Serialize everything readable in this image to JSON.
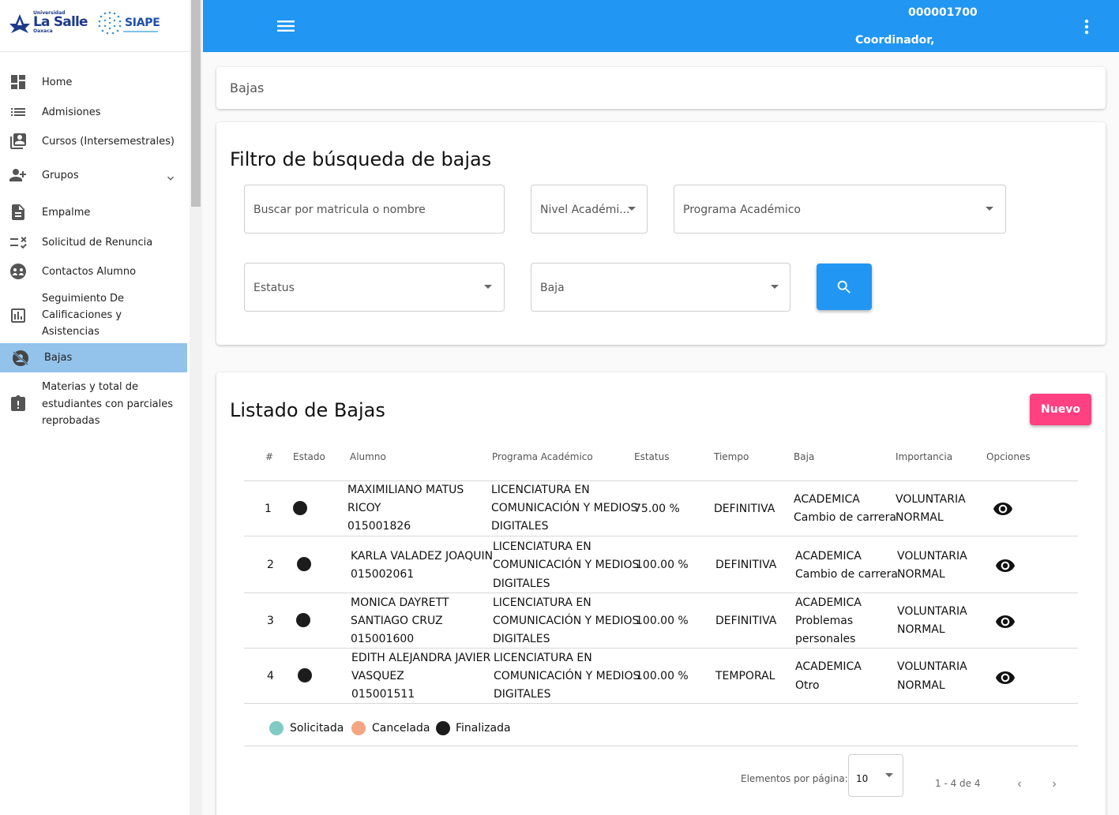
{
  "brand": {
    "university_small": "Universidad",
    "university_name": "La Salle",
    "university_city": "Oaxaca",
    "system_name": "SIAPE"
  },
  "topbar": {
    "user_id": "000001700",
    "user_role": "Coordinador,"
  },
  "sidebar": {
    "items": [
      {
        "label": "Home",
        "icon": "dashboard-icon"
      },
      {
        "label": "Admisiones",
        "icon": "list-icon"
      },
      {
        "label": "Cursos (Intersemestrales)",
        "icon": "courses-icon"
      },
      {
        "label": "Grupos",
        "icon": "group-add-icon"
      },
      {
        "label": "Empalme",
        "icon": "document-icon"
      },
      {
        "label": "Solicitud de Renuncia",
        "icon": "rule-icon"
      },
      {
        "label": "Contactos Alumno",
        "icon": "contacts-icon"
      },
      {
        "label": "Seguimiento De",
        "label2": "Calificaciones y",
        "label3": "Asistencias",
        "icon": "chart-icon"
      },
      {
        "label": "Bajas",
        "icon": "no-person-icon",
        "active": true
      },
      {
        "label": "Materias y total de",
        "label2": "estudiantes con parciales",
        "label3": "reprobadas",
        "icon": "report-icon"
      }
    ]
  },
  "breadcrumb": "Bajas",
  "filter": {
    "title": "Filtro de búsqueda de bajas",
    "search_placeholder": "Buscar por matricula o nombre",
    "nivel": "Nivel Académi...",
    "programa": "Programa Académico",
    "estatus": "Estatus",
    "baja": "Baja"
  },
  "listing": {
    "title": "Listado de Bajas",
    "new_button": "Nuevo",
    "columns": [
      "#",
      "Estado",
      "Alumno",
      "Programa Académico",
      "Estatus",
      "Tiempo",
      "Baja",
      "Importancia",
      "Opciones"
    ],
    "rows": [
      {
        "n": "1",
        "alumno": [
          "MAXIMILIANO MATUS",
          "RICOY",
          "015001826"
        ],
        "programa": [
          "LICENCIATURA EN",
          "COMUNICACIÓN Y MEDIOS",
          "DIGITALES"
        ],
        "estatus": "75.00 %",
        "tiempo": "DEFINITIVA",
        "baja": [
          "ACADEMICA",
          "Cambio de carrera"
        ],
        "importancia": [
          "VOLUNTARIA",
          "NORMAL"
        ]
      },
      {
        "n": "2",
        "alumno": [
          "KARLA VALADEZ JOAQUIN",
          "015002061"
        ],
        "programa": [
          "LICENCIATURA EN",
          "COMUNICACIÓN Y MEDIOS",
          "DIGITALES"
        ],
        "estatus": "100.00 %",
        "tiempo": "DEFINITIVA",
        "baja": [
          "ACADEMICA",
          "Cambio de carrera"
        ],
        "importancia": [
          "VOLUNTARIA",
          "NORMAL"
        ]
      },
      {
        "n": "3",
        "alumno": [
          "MONICA DAYRETT",
          "SANTIAGO CRUZ",
          "015001600"
        ],
        "programa": [
          "LICENCIATURA EN",
          "COMUNICACIÓN Y MEDIOS",
          "DIGITALES"
        ],
        "estatus": "100.00 %",
        "tiempo": "DEFINITIVA",
        "baja": [
          "ACADEMICA",
          "Problemas",
          "personales"
        ],
        "importancia": [
          "VOLUNTARIA",
          "NORMAL"
        ]
      },
      {
        "n": "4",
        "alumno": [
          "EDITH ALEJANDRA JAVIER",
          "VASQUEZ",
          "015001511"
        ],
        "programa": [
          "LICENCIATURA EN",
          "COMUNICACIÓN Y MEDIOS",
          "DIGITALES"
        ],
        "estatus": "100.00 %",
        "tiempo": "TEMPORAL",
        "baja": [
          "ACADEMICA",
          "Otro"
        ],
        "importancia": [
          "VOLUNTARIA",
          "NORMAL"
        ]
      }
    ],
    "legend": [
      {
        "label": "Solicitada",
        "color": "#80cbc4"
      },
      {
        "label": "Cancelada",
        "color": "#f4a582"
      },
      {
        "label": "Finalizada",
        "color": "#1c1c1c"
      }
    ]
  },
  "pagination": {
    "per_page_label": "Elementos por página:",
    "per_page_value": "10",
    "range": "1 - 4 de 4"
  },
  "colors": {
    "primary": "#2196f3",
    "accent": "#ff4081",
    "active_nav": "#93c3ea"
  }
}
